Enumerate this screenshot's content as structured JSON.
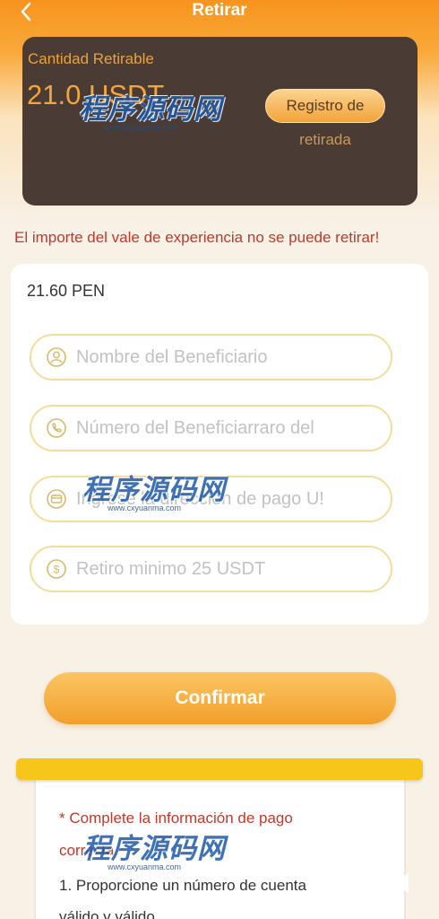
{
  "header": {
    "title": "Retirar",
    "back_icon": "chevron-left-icon"
  },
  "balance": {
    "label": "Cantidad Retirable",
    "amount": "21.0 USDT",
    "history_line1": "Registro de",
    "history_line2": "retirada"
  },
  "warning": "El importe del vale de experiencia no se puede retirar!",
  "form": {
    "amount_display": "21.60 PEN",
    "fields": [
      {
        "placeholder": "Nombre del Beneficiario",
        "icon": "user-icon"
      },
      {
        "placeholder": "Número del Beneficiarraro del",
        "icon": "phone-icon"
      },
      {
        "placeholder": "Ingrese la dirección de pago U!",
        "icon": "card-icon"
      },
      {
        "placeholder": "Retiro minimo 25 USDT",
        "icon": "coin-icon"
      }
    ]
  },
  "confirm_label": "Confirmar",
  "notes": {
    "line1": "* Complete la información de pago",
    "line2": "correcta",
    "line3": "1. Proporcione un número de cuenta",
    "line4": "válido y válido"
  },
  "watermark": {
    "title": "程序源码网",
    "url": "www.cxyuanma.com"
  },
  "colors": {
    "accent": "#f7941d",
    "card_dark": "#4a3b35",
    "warning": "#c0392b",
    "field_border": "#f4dc9c"
  }
}
